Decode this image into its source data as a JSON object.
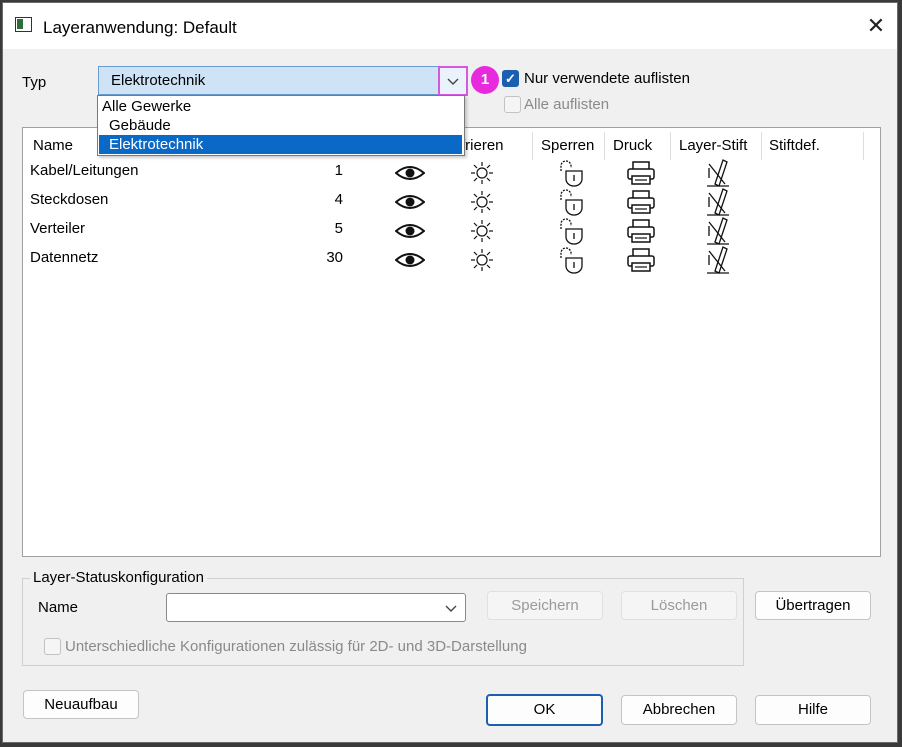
{
  "window": {
    "title": "Layeranwendung: Default",
    "close": "✕"
  },
  "typ": {
    "label": "Typ",
    "selected": "Elektrotechnik",
    "options": [
      "Alle Gewerke",
      "Gebäude",
      "Elektrotechnik"
    ],
    "badge": "1"
  },
  "filters": {
    "used_only": "Nur verwendete auflisten",
    "list_all": "Alle auflisten"
  },
  "table": {
    "headers": [
      "Name",
      "frieren",
      "Sperren",
      "Druck",
      "Layer-Stift",
      "Stiftdef."
    ],
    "rows": [
      {
        "name": "Kabel/Leitungen",
        "count": "1"
      },
      {
        "name": "Steckdosen",
        "count": "4"
      },
      {
        "name": "Verteiler",
        "count": "5"
      },
      {
        "name": "Datennetz",
        "count": "30"
      }
    ]
  },
  "status_config": {
    "group_label": "Layer-Statuskonfiguration",
    "name_label": "Name",
    "name_value": "",
    "save": "Speichern",
    "delete": "Löschen",
    "transfer": "Übertragen",
    "allow_label": "Unterschiedliche Konfigurationen zulässig für 2D- und 3D-Darstellung"
  },
  "buttons": {
    "rebuild": "Neuaufbau",
    "ok": "OK",
    "cancel": "Abbrechen",
    "help": "Hilfe"
  },
  "colors": {
    "accent": "#0a69c7",
    "badge": "#e82adf",
    "combo_bg": "#cfe3f6"
  }
}
